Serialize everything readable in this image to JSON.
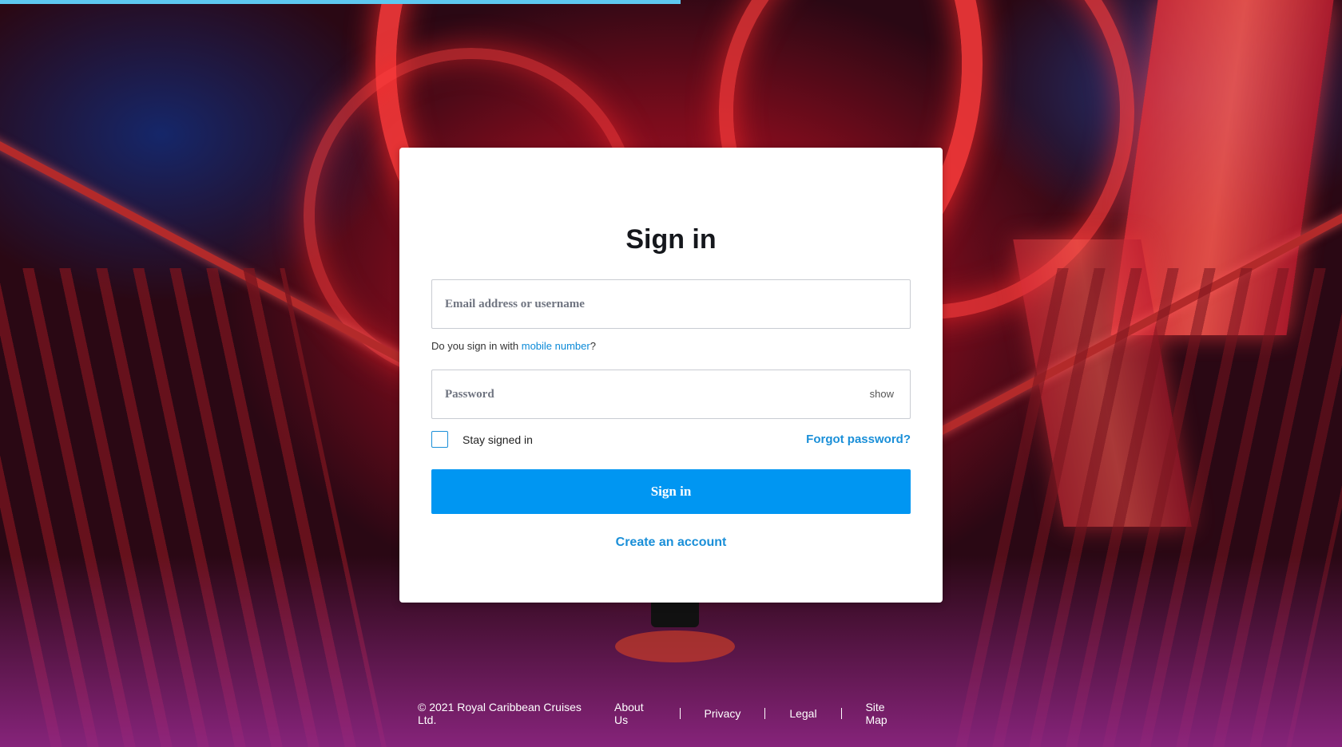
{
  "page": {
    "title": "Sign in"
  },
  "form": {
    "email_placeholder": "Email address or username",
    "hint_prefix": "Do you sign in with ",
    "hint_link": "mobile number",
    "hint_suffix": "?",
    "password_placeholder": "Password",
    "show_label": "show",
    "stay_signed_in_label": "Stay signed in",
    "stay_signed_in_checked": false,
    "forgot_password_label": "Forgot password?",
    "signin_button_label": "Sign in",
    "create_account_label": "Create an account"
  },
  "footer": {
    "copyright": "© 2021 Royal Caribbean Cruises Ltd.",
    "links": [
      "About Us",
      "Privacy",
      "Legal",
      "Site Map"
    ]
  },
  "colors": {
    "accent": "#0096f2",
    "link": "#1a8fd8",
    "progress": "#5ec8f0"
  },
  "icons": {
    "checkbox": "checkbox-unchecked"
  }
}
